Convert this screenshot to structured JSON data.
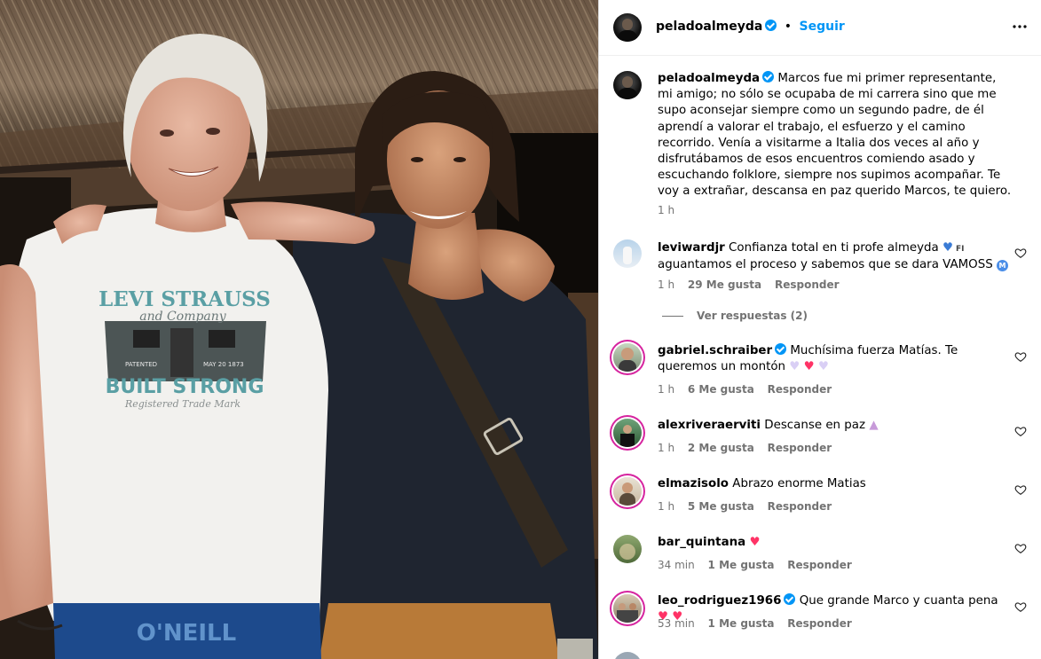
{
  "post": {
    "owner": "peladoalmeyda",
    "follow_label": "Seguir",
    "dot": "•",
    "more_label": "•••",
    "photo_shirt_text": {
      "line1": "LEVI STRAUSS",
      "line2": "and Company",
      "line3": "BUILT STRONG",
      "line4": "Registered Trade Mark",
      "badge_left": "PATENTED",
      "badge_right": "MAY 20 1873"
    },
    "photo_shorts_text": "O'NEILL",
    "caption_username": "peladoalmeyda",
    "caption": "Marcos fue mi primer representante, mi amigo; no sólo se ocupaba de mi carrera sino que me supo aconsejar siempre como un segundo padre, de él aprendí a valorar el trabajo, el esfuerzo y el camino recorrido. Venía a visitarme a Italia dos veces al año y disfrutábamos de esos encuentros comiendo asado y escuchando folklore, siempre nos supimos acompañar. Te voy a extrañar, descansa en paz querido Marcos, te quiero.",
    "caption_time": "1 h"
  },
  "comments": [
    {
      "user": "leviwardjr",
      "text": "Confianza total en ti profe almeyda",
      "text_tail": "aguantamos el proceso y sabemos que se dara VAMOSS",
      "time": "1 h",
      "likes": "29 Me gusta",
      "reply": "Responder",
      "view_replies": "Ver respuestas (2)",
      "badge": "FI",
      "m_badge": "M"
    },
    {
      "user": "gabriel.schraiber",
      "text": "Muchísima fuerza Matías. Te queremos un montón",
      "time": "1 h",
      "likes": "6 Me gusta",
      "reply": "Responder"
    },
    {
      "user": "alexriveraerviti",
      "text": "Descanse en paz",
      "time": "1 h",
      "likes": "2 Me gusta",
      "reply": "Responder"
    },
    {
      "user": "elmazisolo",
      "text": "Abrazo enorme Matias",
      "time": "1 h",
      "likes": "5 Me gusta",
      "reply": "Responder"
    },
    {
      "user": "bar_quintana",
      "text": "",
      "time": "34 min",
      "likes": "1 Me gusta",
      "reply": "Responder"
    },
    {
      "user": "leo_rodriguez1966",
      "text": "Que grande Marco y cuanta pena",
      "time": "53 min",
      "likes": "1 Me gusta",
      "reply": "Responder"
    }
  ],
  "icons": {
    "verified": "verified-badge-icon",
    "like": "heart-outline-icon",
    "more": "more-options-icon"
  },
  "colors": {
    "accent": "#0095f6",
    "muted": "#737373",
    "story_ring": "#d6249f",
    "heart": "#ff3366"
  }
}
